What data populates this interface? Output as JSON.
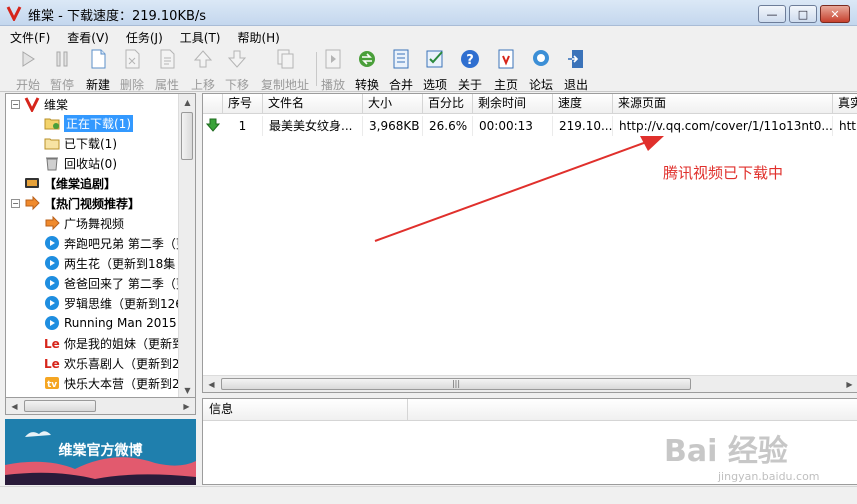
{
  "window": {
    "title": "维棠 - 下载速度：219.10KB/s",
    "minimize": "—",
    "maximize": "□",
    "close": "✕"
  },
  "menu": [
    "文件(F)",
    "查看(V)",
    "任务(J)",
    "工具(T)",
    "帮助(H)"
  ],
  "toolbar": [
    {
      "label": "开始",
      "enabled": false,
      "icon": "play-icon"
    },
    {
      "label": "暂停",
      "enabled": false,
      "icon": "pause-icon"
    },
    {
      "label": "新建",
      "enabled": true,
      "icon": "new-file-icon"
    },
    {
      "label": "删除",
      "enabled": false,
      "icon": "delete-icon"
    },
    {
      "label": "属性",
      "enabled": false,
      "icon": "properties-icon"
    },
    {
      "label": "上移",
      "enabled": false,
      "icon": "move-up-icon"
    },
    {
      "label": "下移",
      "enabled": false,
      "icon": "move-down-icon"
    },
    {
      "label": "复制地址",
      "enabled": false,
      "icon": "copy-address-icon"
    },
    {
      "label": "播放",
      "enabled": false,
      "icon": "play-media-icon"
    },
    {
      "label": "转换",
      "enabled": true,
      "icon": "convert-icon"
    },
    {
      "label": "合并",
      "enabled": true,
      "icon": "merge-icon"
    },
    {
      "label": "选项",
      "enabled": true,
      "icon": "options-icon"
    },
    {
      "label": "关于",
      "enabled": true,
      "icon": "about-icon"
    },
    {
      "label": "主页",
      "enabled": true,
      "icon": "homepage-icon"
    },
    {
      "label": "论坛",
      "enabled": true,
      "icon": "forum-icon"
    },
    {
      "label": "退出",
      "enabled": true,
      "icon": "exit-icon"
    }
  ],
  "tree": {
    "root": "维棠",
    "downloading": "正在下载(1)",
    "downloaded": "已下载(1)",
    "recycle": "回收站(0)",
    "drama": "【维棠追剧】",
    "hot": "【热门视频推荐】",
    "items": [
      "广场舞视频",
      "奔跑吧兄弟 第二季（更",
      "两生花（更新到18集",
      "爸爸回来了 第二季（更",
      "罗辑思维（更新到126",
      "Running Man 2015",
      "你是我的姐妹（更新到",
      "欢乐喜剧人（更新到2",
      "快乐大本营（更新到2"
    ]
  },
  "banner": {
    "text": "维棠官方微博"
  },
  "columns": [
    "序号",
    "文件名",
    "大小",
    "百分比",
    "剩余时间",
    "速度",
    "来源页面",
    "真实"
  ],
  "rows": [
    {
      "index": "1",
      "filename": "最美美女纹身...",
      "size": "3,968KB",
      "percent": "26.6%",
      "remaining": "00:00:13",
      "speed": "219.10...",
      "source": "http://v.qq.com/cover/1/11o13nt0...",
      "real": "htt"
    }
  ],
  "info": {
    "header": "信息"
  },
  "annotation": {
    "text": "腾讯视频已下载中"
  },
  "watermark": {
    "text": "Bai 经验",
    "url": "jingyan.baidu.com"
  },
  "colors": {
    "accent": "#3399ff",
    "annotation": "#e0302c",
    "banner": "#1f7fad"
  }
}
